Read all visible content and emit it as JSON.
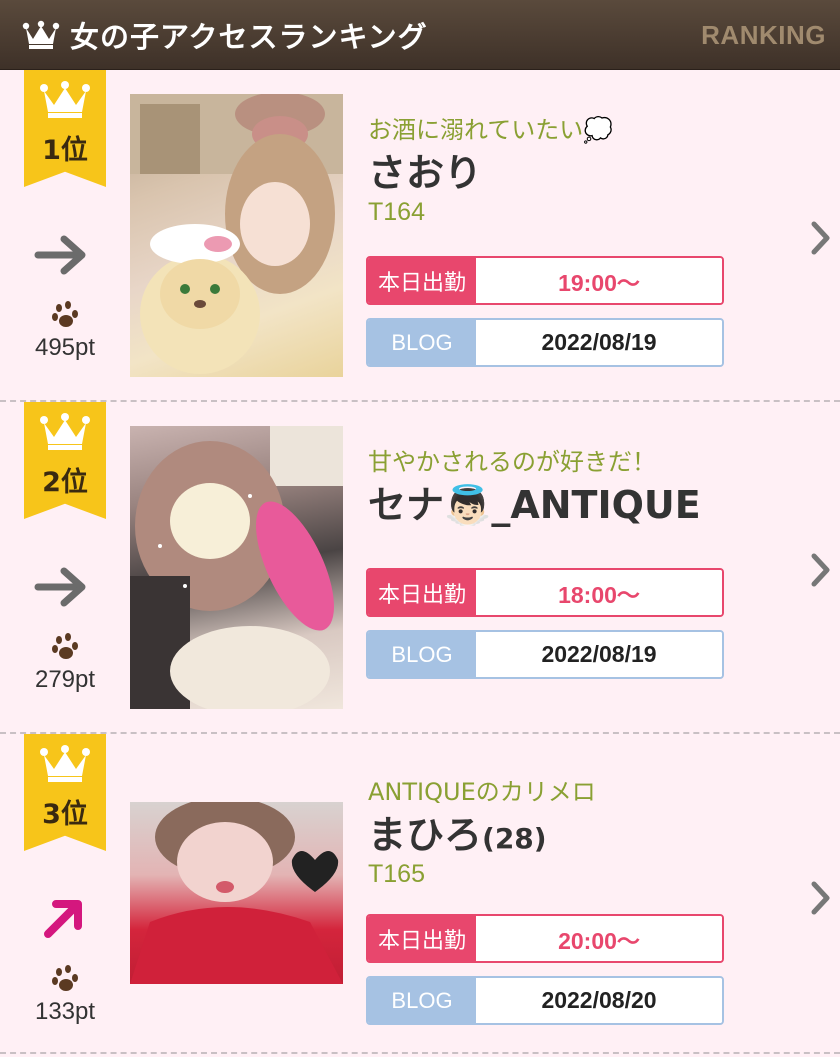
{
  "header": {
    "title": "女の子アクセスランキング",
    "subtitle": "RANKING"
  },
  "rankings": [
    {
      "rank": "1位",
      "trend": "flat",
      "points": "495pt",
      "catchcopy": "お酒に溺れていたい💭",
      "name": "さおり",
      "age": "",
      "height": "T164",
      "work_label": "本日出勤",
      "work_time": "19:00〜",
      "blog_label": "BLOG",
      "blog_date": "2022/08/19"
    },
    {
      "rank": "2位",
      "trend": "flat",
      "points": "279pt",
      "catchcopy": "甘やかされるのが好きだ！",
      "name": "セナ👼🏻_ANTIQUE",
      "age": "",
      "height": "",
      "work_label": "本日出勤",
      "work_time": "18:00〜",
      "blog_label": "BLOG",
      "blog_date": "2022/08/19"
    },
    {
      "rank": "3位",
      "trend": "up",
      "points": "133pt",
      "catchcopy": "ANTIQUEのカリメロ",
      "name": "まひろ",
      "age": "(28)",
      "height": "T165",
      "work_label": "本日出勤",
      "work_time": "20:00〜",
      "blog_label": "BLOG",
      "blog_date": "2022/08/20"
    }
  ],
  "icons": {
    "header": "crown-icon",
    "badge": "crown-icon",
    "trend_flat": "arrow-right-icon",
    "trend_up": "arrow-up-right-icon",
    "points": "paw-icon",
    "link": "chevron-right-icon"
  },
  "colors": {
    "header_bg": "#4a3c30",
    "page_bg": "#fff0f5",
    "badge": "#f7c51a",
    "accent_green": "#8aa033",
    "work_pink": "#e8476d",
    "blog_blue": "#a6c2e3",
    "trend_up": "#d4177e"
  }
}
